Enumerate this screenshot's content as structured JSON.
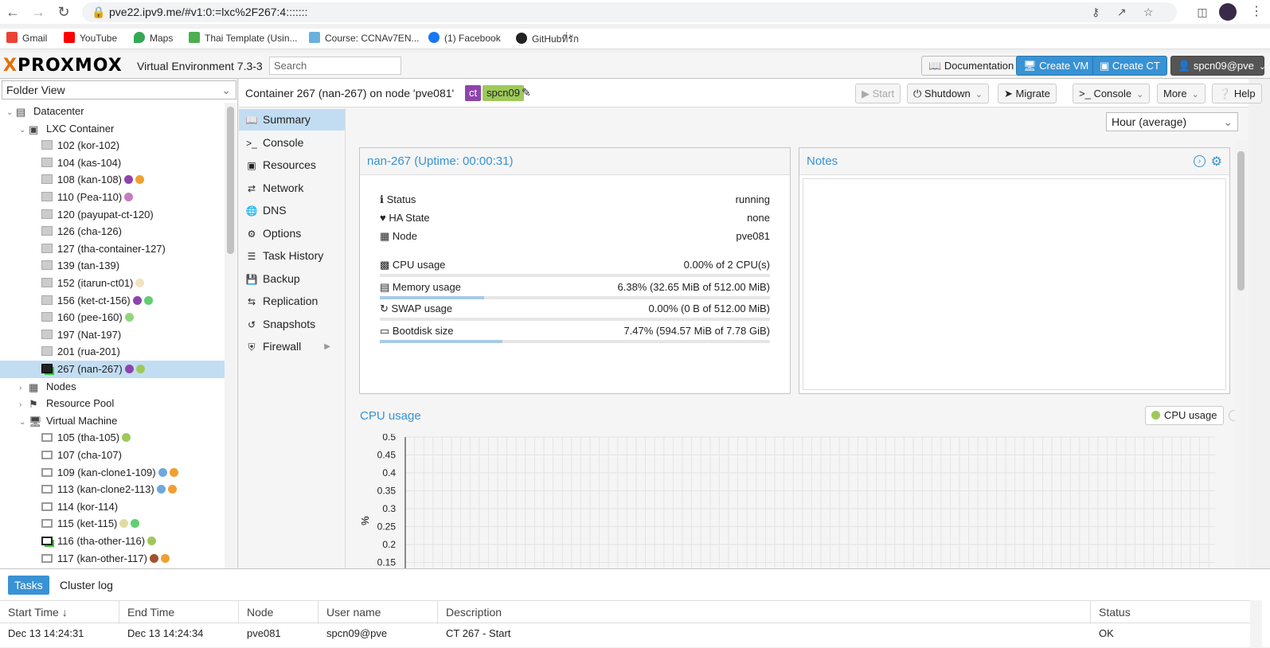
{
  "browser": {
    "url": "pve22.ipv9.me/#v1:0:=lxc%2F267:4:::::::",
    "bookmarks": [
      "Gmail",
      "YouTube",
      "Maps",
      "Thai Template (Usin...",
      "Course: CCNAv7EN...",
      "(1) Facebook",
      "GitHubที่รัก"
    ]
  },
  "header": {
    "logo_text": "PROXMOX",
    "version": "Virtual Environment 7.3-3",
    "search_placeholder": "Search",
    "documentation": "Documentation",
    "create_vm": "Create VM",
    "create_ct": "Create CT",
    "user": "spcn09@pve"
  },
  "sidebar": {
    "view": "Folder View",
    "tree": [
      {
        "label": "Datacenter",
        "level": 0,
        "icon": "datacenter-icon",
        "toggle": "v"
      },
      {
        "label": "LXC Container",
        "level": 1,
        "icon": "container-group-icon",
        "toggle": "v"
      },
      {
        "label": "102 (kor-102)",
        "level": 2,
        "icon": "container-icon",
        "dots": []
      },
      {
        "label": "104 (kas-104)",
        "level": 2,
        "icon": "container-icon",
        "dots": []
      },
      {
        "label": "108 (kan-108)",
        "level": 2,
        "icon": "container-icon",
        "dots": [
          "#8e44ad",
          "#f0a030"
        ]
      },
      {
        "label": "110 (Pea-110)",
        "level": 2,
        "icon": "container-icon",
        "dots": [
          "#c67cbf"
        ]
      },
      {
        "label": "120 (payupat-ct-120)",
        "level": 2,
        "icon": "container-icon",
        "dots": []
      },
      {
        "label": "126 (cha-126)",
        "level": 2,
        "icon": "container-icon",
        "dots": []
      },
      {
        "label": "127 (tha-container-127)",
        "level": 2,
        "icon": "container-icon",
        "dots": []
      },
      {
        "label": "139 (tan-139)",
        "level": 2,
        "icon": "container-icon",
        "dots": []
      },
      {
        "label": "152 (itarun-ct01)",
        "level": 2,
        "icon": "container-icon",
        "dots": [
          "#f2e2c2"
        ]
      },
      {
        "label": "156 (ket-ct-156)",
        "level": 2,
        "icon": "container-icon",
        "dots": [
          "#8e44ad",
          "#5fcf6f"
        ]
      },
      {
        "label": "160 (pee-160)",
        "level": 2,
        "icon": "container-icon",
        "dots": [
          "#8fd67a"
        ]
      },
      {
        "label": "197 (Nat-197)",
        "level": 2,
        "icon": "container-icon",
        "dots": []
      },
      {
        "label": "201 (rua-201)",
        "level": 2,
        "icon": "container-icon",
        "dots": []
      },
      {
        "label": "267 (nan-267)",
        "level": 2,
        "icon": "container-running-icon",
        "dots": [
          "#8e44ad",
          "#9ec95a"
        ],
        "selected": true
      },
      {
        "label": "Nodes",
        "level": 1,
        "icon": "nodes-icon",
        "toggle": ">"
      },
      {
        "label": "Resource Pool",
        "level": 1,
        "icon": "tags-icon",
        "toggle": ">"
      },
      {
        "label": "Virtual Machine",
        "level": 1,
        "icon": "monitor-icon",
        "toggle": "v"
      },
      {
        "label": "105 (tha-105)",
        "level": 2,
        "icon": "vm-icon",
        "dots": [
          "#9ec95a"
        ]
      },
      {
        "label": "107 (cha-107)",
        "level": 2,
        "icon": "vm-icon",
        "dots": []
      },
      {
        "label": "109 (kan-clone1-109)",
        "level": 2,
        "icon": "vm-icon",
        "dots": [
          "#6fa8dc",
          "#f0a030"
        ]
      },
      {
        "label": "113 (kan-clone2-113)",
        "level": 2,
        "icon": "vm-icon",
        "dots": [
          "#6fa8dc",
          "#f0a030"
        ]
      },
      {
        "label": "114 (kor-114)",
        "level": 2,
        "icon": "vm-icon",
        "dots": []
      },
      {
        "label": "115 (ket-115)",
        "level": 2,
        "icon": "vm-icon",
        "dots": [
          "#e0dca0",
          "#5fcf6f"
        ]
      },
      {
        "label": "116 (tha-other-116)",
        "level": 2,
        "icon": "vm-running-icon",
        "dots": [
          "#9ec95a"
        ]
      },
      {
        "label": "117 (kan-other-117)",
        "level": 2,
        "icon": "vm-icon",
        "dots": [
          "#a0522d",
          "#f0a030"
        ]
      }
    ]
  },
  "toolbar": {
    "title": "Container 267 (nan-267) on node 'pve081'",
    "tags": [
      "ct",
      "spcn09"
    ],
    "start": "Start",
    "shutdown": "Shutdown",
    "migrate": "Migrate",
    "console": "Console",
    "more": "More",
    "help": "Help"
  },
  "menu": [
    {
      "label": "Summary",
      "icon": "book-icon",
      "selected": true
    },
    {
      "label": "Console",
      "icon": "terminal-icon"
    },
    {
      "label": "Resources",
      "icon": "cube-icon"
    },
    {
      "label": "Network",
      "icon": "exchange-icon"
    },
    {
      "label": "DNS",
      "icon": "globe-icon"
    },
    {
      "label": "Options",
      "icon": "gear-icon"
    },
    {
      "label": "Task History",
      "icon": "list-icon"
    },
    {
      "label": "Backup",
      "icon": "floppy-icon"
    },
    {
      "label": "Replication",
      "icon": "retweet-icon"
    },
    {
      "label": "Snapshots",
      "icon": "history-icon"
    },
    {
      "label": "Firewall",
      "icon": "shield-icon",
      "submenu": true
    }
  ],
  "summary": {
    "timeframe": "Hour (average)",
    "status_title": "nan-267 (Uptime: 00:00:31)",
    "rows": [
      {
        "label": "Status",
        "value": "running",
        "icon": "info-icon"
      },
      {
        "label": "HA State",
        "value": "none",
        "icon": "heartbeat-icon"
      },
      {
        "label": "Node",
        "value": "pve081",
        "icon": "server-icon"
      }
    ],
    "usage": [
      {
        "label": "CPU usage",
        "value": "0.00% of 2 CPU(s)",
        "fraction": 0.0,
        "icon": "cpu-icon"
      },
      {
        "label": "Memory usage",
        "value": "6.38% (32.65 MiB of 512.00 MiB)",
        "fraction": 0.0638,
        "icon": "memory-icon"
      },
      {
        "label": "SWAP usage",
        "value": "0.00% (0 B of 512.00 MiB)",
        "fraction": 0.0,
        "icon": "refresh-icon"
      },
      {
        "label": "Bootdisk size",
        "value": "7.47% (594.57 MiB of 7.78 GiB)",
        "fraction": 0.0747,
        "icon": "hdd-icon"
      }
    ],
    "notes_title": "Notes"
  },
  "chart_data": {
    "type": "line",
    "title": "CPU usage",
    "legend": [
      "CPU usage"
    ],
    "legend_color": "#9ec95a",
    "ylabel": "%",
    "yticks": [
      "0.5",
      "0.45",
      "0.4",
      "0.35",
      "0.3",
      "0.25",
      "0.2",
      "0.15"
    ],
    "ylim": [
      0,
      0.5
    ],
    "series": [
      {
        "name": "CPU usage",
        "values": []
      }
    ]
  },
  "bottom": {
    "tabs": [
      "Tasks",
      "Cluster log"
    ],
    "columns": [
      "Start Time",
      "End Time",
      "Node",
      "User name",
      "Description",
      "Status"
    ],
    "rows": [
      [
        "Dec 13 14:24:31",
        "Dec 13 14:24:34",
        "pve081",
        "spcn09@pve",
        "CT 267 - Start",
        "OK"
      ]
    ]
  }
}
